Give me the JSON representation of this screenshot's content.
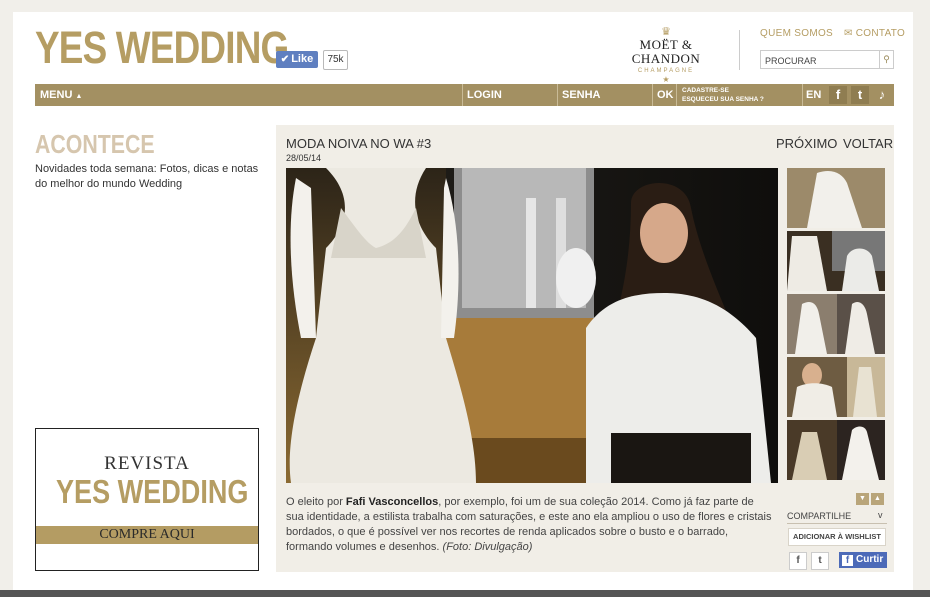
{
  "header": {
    "logo": "YES WEDDING",
    "like_label": "Like",
    "like_count": "75k",
    "sponsor": {
      "brand": "MOËT & CHANDON",
      "sub": "CHAMPAGNE"
    },
    "links": {
      "quem_somos": "QUEM SOMOS",
      "contato": "CONTATO"
    },
    "search_placeholder": "PROCURAR"
  },
  "nav": {
    "menu": "MENU",
    "login": "LOGIN",
    "senha": "SENHA",
    "ok": "OK",
    "cadastre": "CADASTRE-SE",
    "esqueceu": "ESQUECEU SUA SENHA ?",
    "lang": "EN"
  },
  "section": {
    "title": "ACONTECE",
    "description": "Novidades toda semana: Fotos, dicas e notas do melhor do mundo Wedding"
  },
  "ad": {
    "line1": "REVISTA",
    "line2": "YES WEDDING",
    "cta": "COMPRE AQUI"
  },
  "post": {
    "title": "MODA NOIVA NO WA #3",
    "date": "28/05/14",
    "next_label": "PRÓXIMO",
    "back_label": "VOLTAR",
    "text_before": "O eleito por ",
    "author": "Fafi Vasconcellos",
    "text_after": ", por exemplo, foi um de sua coleção 2014. Como já faz parte de sua identidade, a estilista trabalha com saturações, e este ano ela ampliou o uso de flores e cristais bordados, o que é possível ver nos recortes de renda aplicados sobre o busto e o barrado, formando volumes e desenhos. ",
    "credit": "(Foto: Divulgação)"
  },
  "share": {
    "label": "COMPARTILHE",
    "wishlist": "ADICIONAR À WISHLIST",
    "curtir": "Curtir"
  },
  "colors": {
    "gold": "#b59d63",
    "nav_bg": "#a39062",
    "panel_bg": "#f1eee7",
    "facebook": "#4c6ab8"
  }
}
